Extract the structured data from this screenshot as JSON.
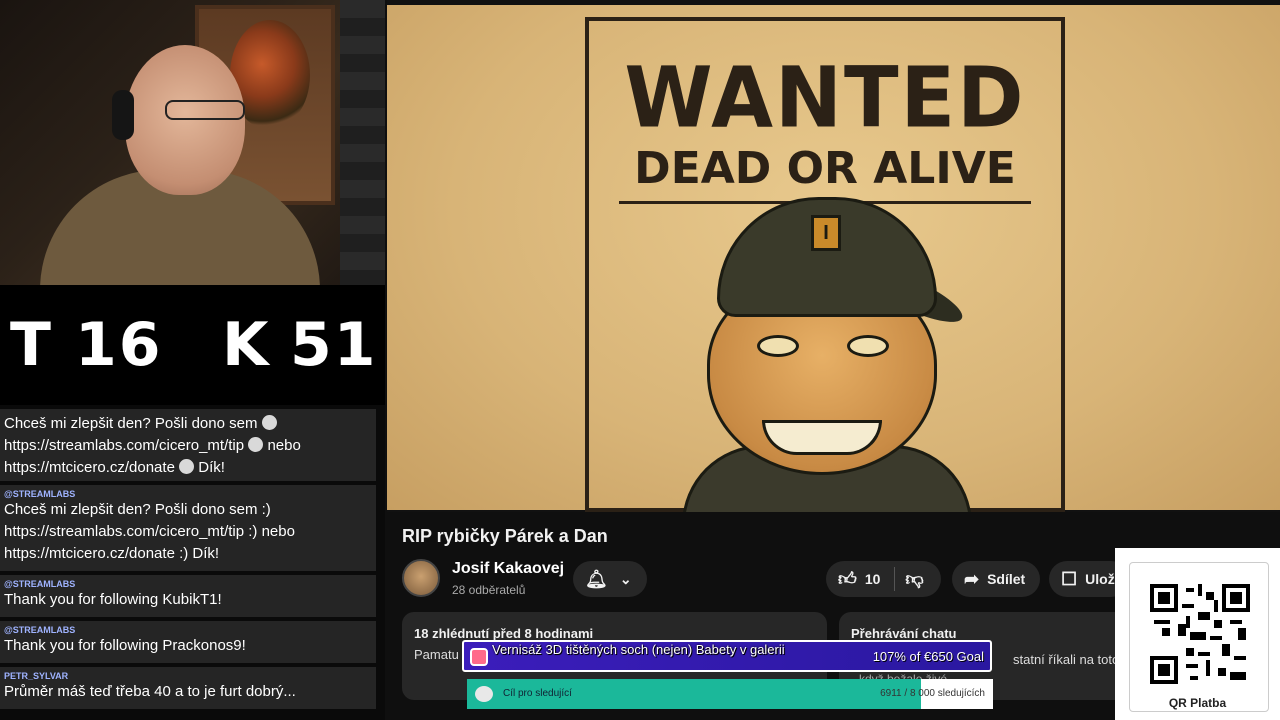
{
  "score": {
    "t_label": "T",
    "t_value": "16",
    "k_label": "K",
    "k_value": "51"
  },
  "chat": {
    "messages": [
      {
        "author": "",
        "text": "Chceš mi zlepšit den? Pošli dono sem",
        "line2": "https://streamlabs.com/cicero_mt/tip",
        "line2b": "nebo",
        "line3": "https://mtcicero.cz/donate",
        "line3b": "Dík!"
      },
      {
        "author": "@STREAMLABS",
        "text": "Chceš mi zlepšit den? Pošli dono sem :)",
        "line2": "https://streamlabs.com/cicero_mt/tip :) nebo",
        "line3": "https://mtcicero.cz/donate :) Dík!"
      },
      {
        "author": "@STREAMLABS",
        "text": "Thank you for following KubikT1!"
      },
      {
        "author": "@STREAMLABS",
        "text": "Thank you for following Prackonos9!"
      },
      {
        "author": "PETR_SYLVAR",
        "text": "Průměr máš teď třeba 40 a to je furt dobrý..."
      }
    ]
  },
  "video": {
    "poster_title": "WANTED",
    "poster_sub": "DEAD OR ALIVE",
    "badge": "I",
    "title": "RIP rybičky Párek a Dan"
  },
  "channel": {
    "name": "Josif Kakaovej",
    "subs": "28 odběratelů"
  },
  "actions": {
    "likes": "10",
    "share": "Sdílet",
    "save": "Ulož"
  },
  "description": {
    "meta": "18 zhlédnutí  před 8 hodinami",
    "body": "Pamatu"
  },
  "chat_replay": {
    "header": "Přehrávání chatu",
    "line1": "statní říkali na toto v",
    "line2": "když bežale živé"
  },
  "donation_goal": {
    "title": "Vernisáž 3D tištěných soch (nejen) Babety v galerii",
    "value": "107% of €650 Goal",
    "progress": 1.0
  },
  "follower_goal": {
    "label": "Cíl pro sledující",
    "value": "6911 / 8 000 sledujících",
    "progress": 0.864
  },
  "qr": {
    "label": "QR Platba"
  }
}
